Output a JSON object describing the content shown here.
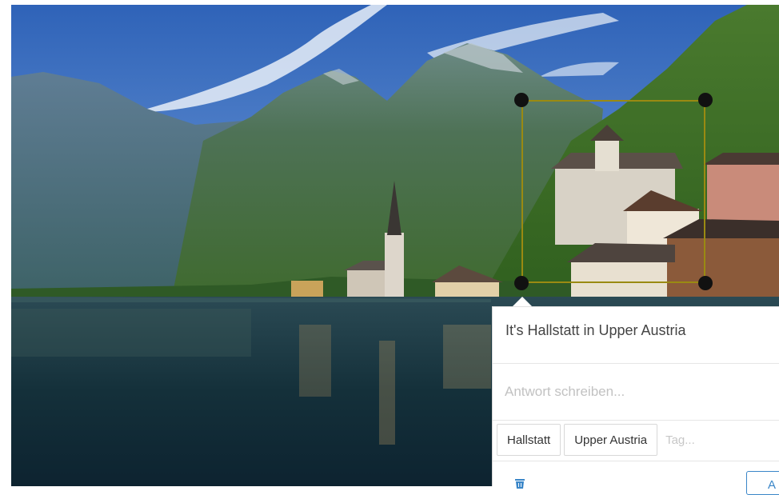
{
  "annotation": {
    "comment": "It's Hallstatt in Upper Austria",
    "reply_placeholder": "Antwort schreiben...",
    "tags": [
      "Hallstatt",
      "Upper Austria"
    ],
    "tag_placeholder": "Tag...",
    "action_label": "A"
  },
  "colors": {
    "box_border": "#9a8a12",
    "handle": "#111111",
    "button_accent": "#3a86c8"
  },
  "icons": {
    "delete": "trash-icon"
  }
}
